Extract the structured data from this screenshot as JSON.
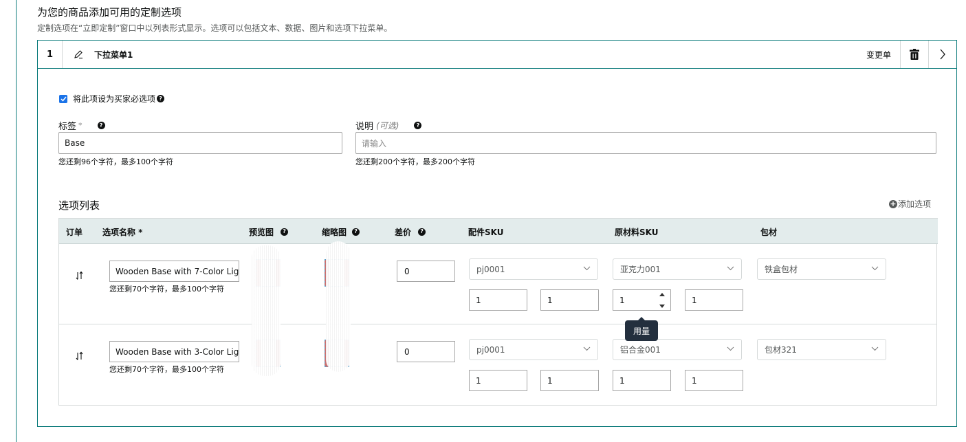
{
  "section": {
    "title": "为您的商品添加可用的定制选项",
    "subtitle": "定制选项在“立即定制”窗口中以列表形式显示。选项可以包括文本、数据、图片和选项下拉菜单。"
  },
  "card": {
    "index": "1",
    "name": "下拉菜单1",
    "change_label": "变更单"
  },
  "required": {
    "checked": true,
    "label": "将此项设为买家必选项"
  },
  "label_field": {
    "label": "标签",
    "req_mark": "*",
    "value": "Base",
    "hint": "您还剩96个字符，最多100个字符"
  },
  "desc_field": {
    "label": "说明",
    "optional": "(可选)",
    "placeholder": "请输入",
    "hint": "您还剩200个字符，最多200个字符"
  },
  "options": {
    "title": "选项列表",
    "add_label": "添加选项",
    "headers": [
      "订单",
      "选项名称 *",
      "预览图",
      "缩略图",
      "差价",
      "配件SKU",
      "原材料SKU",
      "包材"
    ],
    "rows": [
      {
        "name": "Wooden Base with 7-Color Lig",
        "hint": "您还剩70个字符，最多100个字符",
        "price": "0",
        "part_sku": "pj0001",
        "raw_sku": "亚克力001",
        "packaging": "铁盒包材",
        "qty": [
          "1",
          "1",
          "1",
          "1"
        ]
      },
      {
        "name": "Wooden Base with 3-Color Lig",
        "hint": "您还剩70个字符，最多100个字符",
        "price": "0",
        "part_sku": "pj0001",
        "raw_sku": "铝合金001",
        "packaging": "包材321",
        "qty": [
          "1",
          "1",
          "1",
          "1"
        ]
      }
    ]
  },
  "tooltip": "用量",
  "icons": {
    "edit": "pencil-icon",
    "trash": "trash-icon",
    "expand": "chevron-right-icon",
    "drag": "drag-icon",
    "help": "question-icon",
    "add": "plus-circle-icon"
  },
  "colors": {
    "accent": "#0a7a7a",
    "checkbox": "#1a73e8",
    "header_bg": "#e3ecec",
    "tooltip_bg": "#232f3e"
  }
}
